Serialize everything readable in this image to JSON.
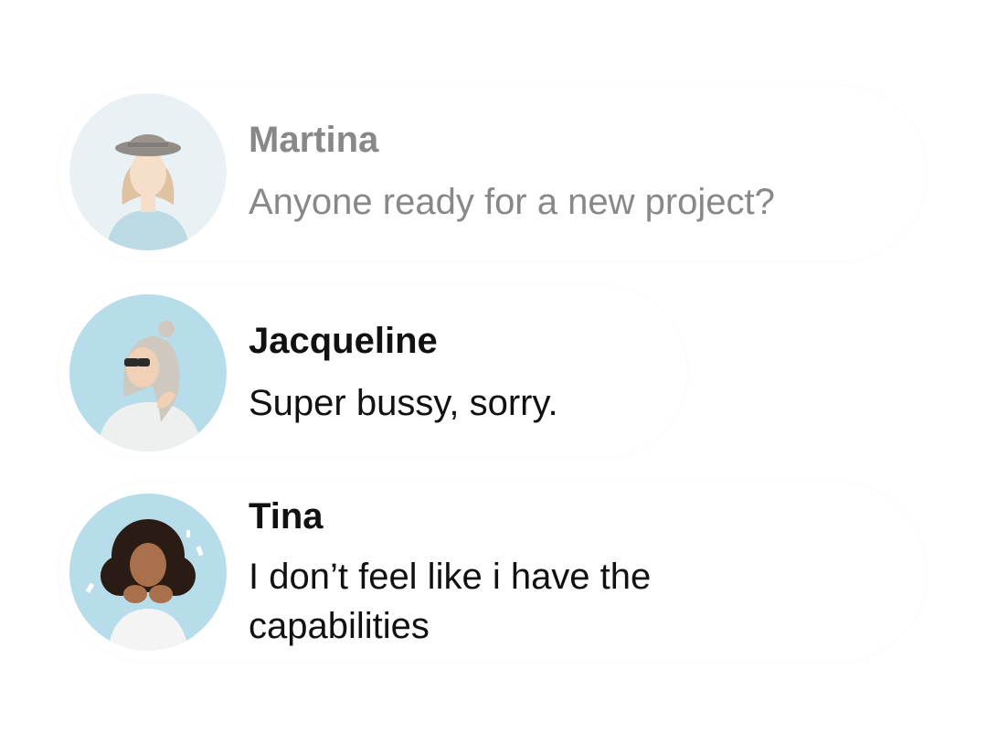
{
  "messages": [
    {
      "sender": "Martina",
      "text": "Anyone ready for a new project?",
      "state": "faded",
      "avatar_icon": "woman-with-hat-avatar"
    },
    {
      "sender": "Jacqueline",
      "text": "Super bussy, sorry.",
      "state": "normal",
      "avatar_icon": "woman-with-sunglasses-avatar"
    },
    {
      "sender": "Tina",
      "text": "I don’t feel like i have the capabilities",
      "state": "normal",
      "avatar_icon": "woman-blowing-confetti-avatar"
    }
  ],
  "colors": {
    "text": "#111111",
    "faded_text": "#888888",
    "avatar_background": "#b7dcea",
    "bubble": "#ffffff"
  }
}
